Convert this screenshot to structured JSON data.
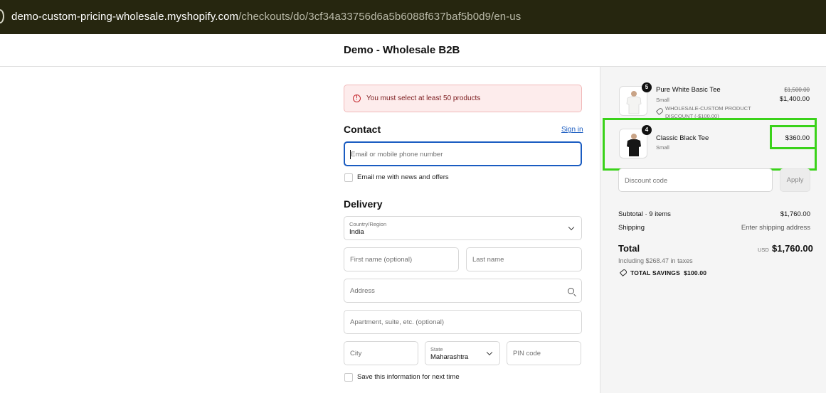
{
  "browser": {
    "url_host": "demo-custom-pricing-wholesale.myshopify.com",
    "url_path": "/checkouts/do/3cf34a33756d6a5b6088f637baf5b0d9/en-us"
  },
  "header": {
    "shop_name": "Demo - Wholesale B2B"
  },
  "error": {
    "message": "You must select at least 50 products"
  },
  "contact": {
    "title": "Contact",
    "sign_in_label": "Sign in",
    "email_placeholder": "Email or mobile phone number",
    "news_checkbox_label": "Email me with news and offers"
  },
  "delivery": {
    "title": "Delivery",
    "country_label": "Country/Region",
    "country_value": "India",
    "first_name_placeholder": "First name (optional)",
    "last_name_placeholder": "Last name",
    "address_placeholder": "Address",
    "apartment_placeholder": "Apartment, suite, etc. (optional)",
    "city_placeholder": "City",
    "state_label": "State",
    "state_value": "Maharashtra",
    "pin_placeholder": "PIN code",
    "save_info_label": "Save this information for next time"
  },
  "cart": {
    "items": [
      {
        "name": "Pure White Basic Tee",
        "variant": "Small",
        "quantity": "5",
        "discount": "WHOLESALE-CUSTOM PRODUCT DISCOUNT (-$100.00)",
        "price_old": "$1,500.00",
        "price": "$1,400.00",
        "shirt_color": "#f4f4f2"
      },
      {
        "name": "Classic Black Tee",
        "variant": "Small",
        "quantity": "4",
        "price": "$360.00",
        "shirt_color": "#161616"
      }
    ],
    "discount_placeholder": "Discount code",
    "apply_label": "Apply",
    "subtotal_label": "Subtotal · 9 items",
    "subtotal_value": "$1,760.00",
    "shipping_label": "Shipping",
    "shipping_value": "Enter shipping address",
    "total_label": "Total",
    "total_currency": "USD",
    "total_value": "$1,760.00",
    "tax_note": "Including $268.47 in taxes",
    "savings_label": "TOTAL SAVINGS",
    "savings_value": "$100.00"
  },
  "colors": {
    "accent_blue": "#1a5cc1",
    "error_red": "#c4282e",
    "highlight_green": "#3ad21a"
  }
}
